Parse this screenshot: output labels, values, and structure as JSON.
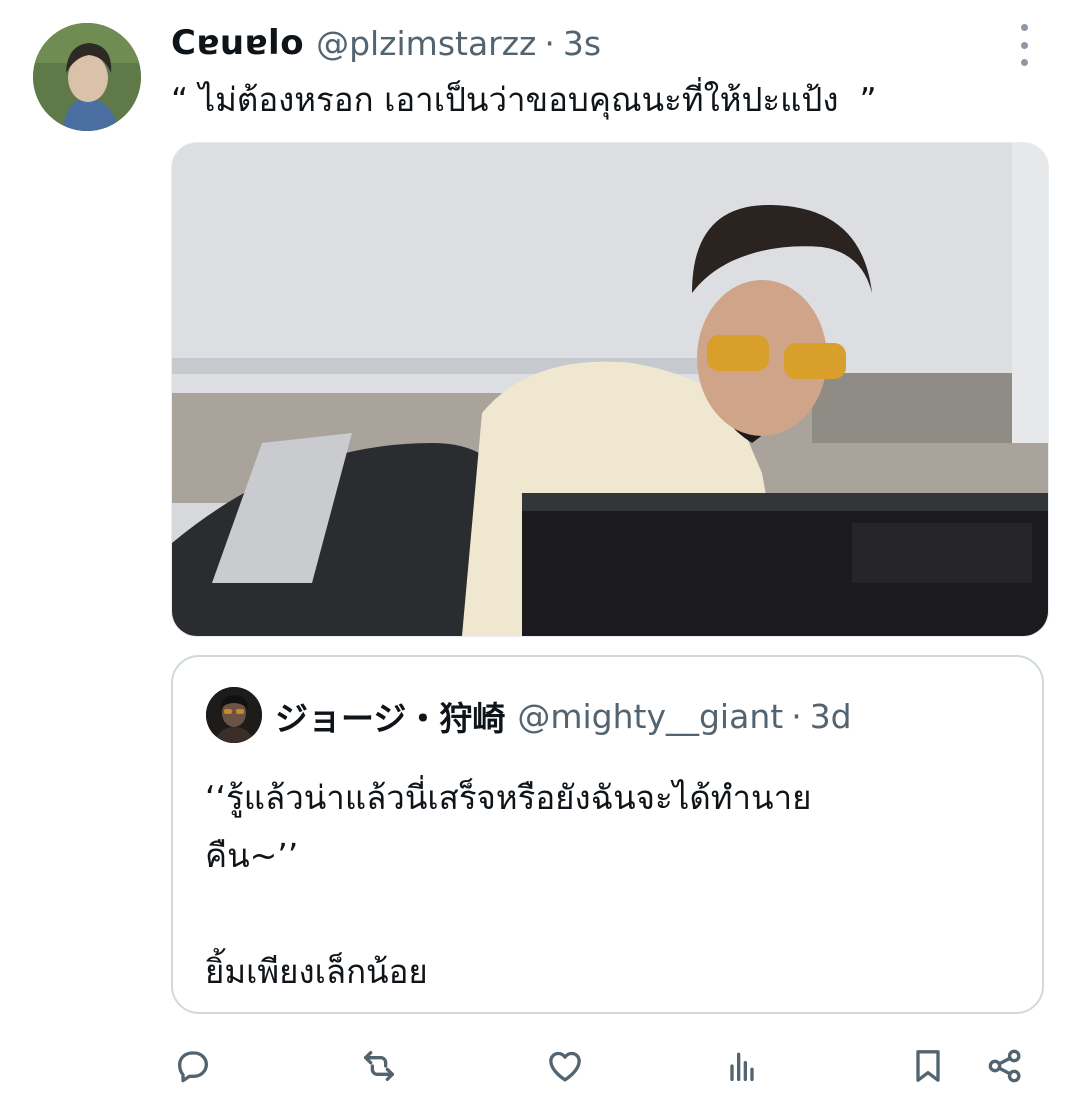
{
  "tweet": {
    "author": {
      "display_name": "Cɐuɐlo",
      "handle": "@plzimstarzz"
    },
    "separator": "·",
    "time": "3s",
    "text": "“ ไม่ต้องหรอก เอาเป็นว่าขอบคุณนะที่ให้ปะแป้ง  ”"
  },
  "quoted": {
    "author": {
      "display_name": "ジョージ・狩崎",
      "handle": "@mighty__giant"
    },
    "separator": "·",
    "time": "3d",
    "text": "‘‘รู้แล้วน่าแล้วนี่เสร็จหรือยังฉันจะได้ทำนาย\nคืน~’’\n\nยิ้มเพียงเล็กน้อย"
  },
  "icons": {
    "more": "more-icon",
    "reply": "reply-icon",
    "retweet": "retweet-icon",
    "like": "like-icon",
    "views": "views-icon",
    "bookmark": "bookmark-icon",
    "share": "share-icon"
  },
  "colors": {
    "text_primary": "#0f1419",
    "text_secondary": "#536471",
    "border": "#cfd9de"
  }
}
